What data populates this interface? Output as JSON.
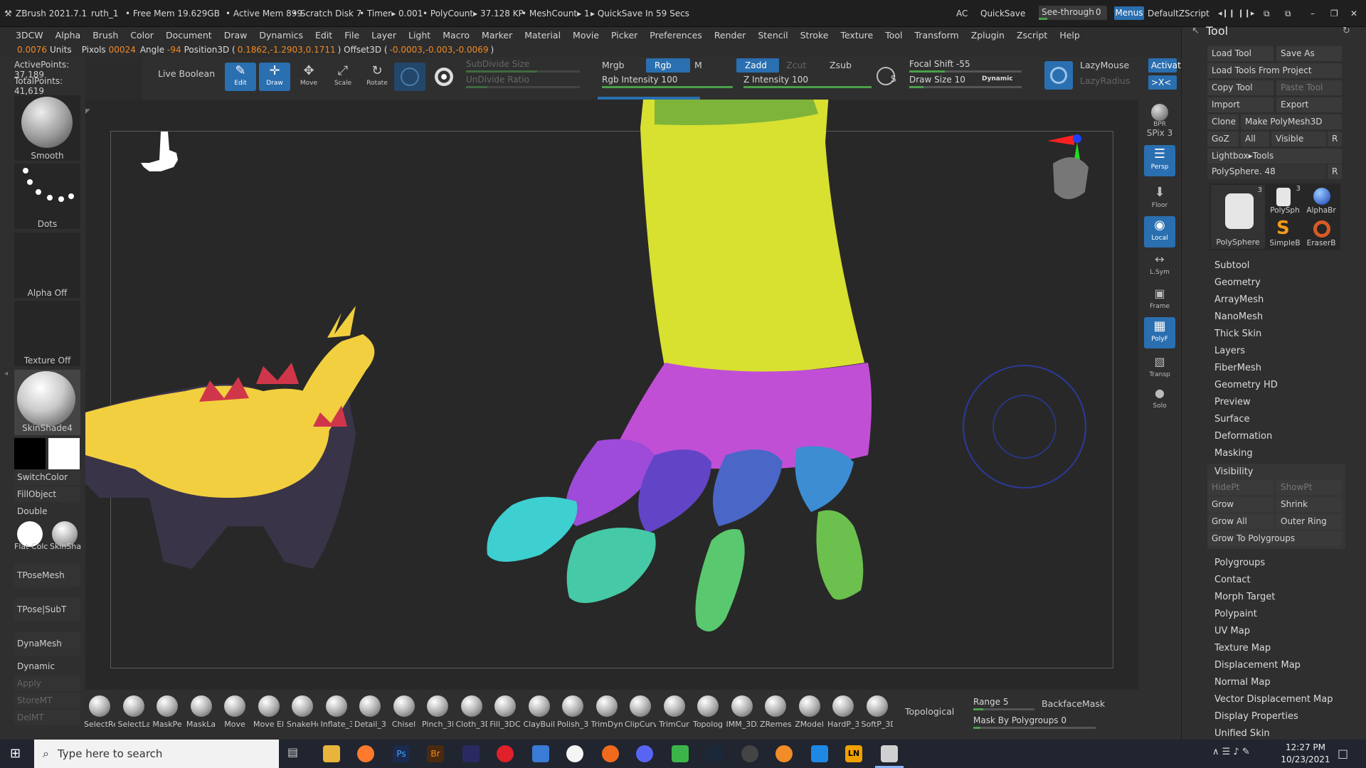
{
  "titlebar": {
    "app": "ZBrush 2021.7.1",
    "doc": "ruth_1",
    "free_mem": "• Free Mem 19.629GB",
    "active_mem": "• Active Mem 899",
    "scratch": "• Scratch Disk 7",
    "timer": "• Timer▸ 0.001",
    "polycount": "• PolyCount▸ 37.128 KP",
    "meshcount": "• MeshCount▸ 1",
    "quicksave_info": "▸ QuickSave In 59 Secs",
    "ac": "AC",
    "quicksave": "QuickSave",
    "see_through": "See-through",
    "see_through_value": "0",
    "menus": "Menus",
    "script": "DefaultZScript"
  },
  "menu": [
    "3DCW",
    "Alpha",
    "Brush",
    "Color",
    "Document",
    "Draw",
    "Dynamics",
    "Edit",
    "File",
    "Layer",
    "Light",
    "Macro",
    "Marker",
    "Material",
    "Movie",
    "Picker",
    "Preferences",
    "Render",
    "Stencil",
    "Stroke",
    "Texture",
    "Tool",
    "Transform",
    "Zplugin",
    "Zscript",
    "Help"
  ],
  "info": {
    "units_value": "0.0076",
    "units_label": "Units",
    "pixols_label": "Pixols",
    "pixols_value": "00024",
    "angle_label": "Angle",
    "angle_value": "-94",
    "pos_label": "Position3D (",
    "pos_value": "0.1862,-1.2903,0.1711",
    "offset_label": ") Offset3D (",
    "offset_value": "-0.0003,-0.003,-0.0069",
    "close": ")"
  },
  "left": {
    "active_points": "ActivePoints: 37,189",
    "total_points": "TotalPoints: 41,619",
    "brush": "Smooth",
    "stroke": "Dots",
    "alpha": "Alpha Off",
    "texture": "Texture Off",
    "material": "SkinShade4",
    "switch_color": "SwitchColor",
    "fill_object": "FillObject",
    "double": "Double",
    "flat_color": "Flat Colc",
    "skin_shade": "SkinSha",
    "tpose_mesh": "TPoseMesh",
    "tpose_subt": "TPose|SubT",
    "dynamesh": "DynaMesh",
    "dynamic": "Dynamic",
    "apply": "Apply",
    "store_mt": "StoreMT",
    "del_mt": "DelMT"
  },
  "shelf": {
    "live_boolean": "Live Boolean",
    "edit": "Edit",
    "draw": "Draw",
    "move": "Move",
    "scale": "Scale",
    "rotate": "Rotate",
    "subdivide_size": "SubDivide Size",
    "undivide_ratio": "UnDivide Ratio",
    "mrgb": "Mrgb",
    "rgb": "Rgb",
    "m": "M",
    "rgb_intensity": "Rgb Intensity 100",
    "zadd": "Zadd",
    "zcut": "Zcut",
    "zsub": "Zsub",
    "z_intensity": "Z Intensity 100",
    "s_label": "S",
    "focal_shift": "Focal Shift -55",
    "draw_size": "Draw Size 10",
    "dynamic": "Dynamic",
    "lazymouse": "LazyMouse",
    "lazyradius": "LazyRadius",
    "activate": "Activat",
    "xsym": ">X<"
  },
  "right_shelf": [
    "BPR",
    "SPix 3",
    "Persp",
    "Floor",
    "Local",
    "L.Sym",
    "Frame",
    "PolyF",
    "Transp",
    "Solo"
  ],
  "tool": {
    "title": "Tool",
    "load_tool": "Load Tool",
    "save_as": "Save As",
    "load_from_project": "Load Tools From Project",
    "copy_tool": "Copy Tool",
    "paste_tool": "Paste Tool",
    "import": "Import",
    "export": "Export",
    "clone": "Clone",
    "make_polymesh": "Make PolyMesh3D",
    "goz": "GoZ",
    "all": "All",
    "visible": "Visible",
    "r": "R",
    "lightbox": "Lightbox▸Tools",
    "polysphere": "PolySphere. 48",
    "thumbs": [
      "PolySphere",
      "PolySph",
      "AlphaBr",
      "SimpleB",
      "EraserB"
    ],
    "thumb_badge_1": "3",
    "thumb_badge_2": "3",
    "sections_a": [
      "Subtool",
      "Geometry",
      "ArrayMesh",
      "NanoMesh",
      "Thick Skin",
      "Layers",
      "FiberMesh",
      "Geometry HD",
      "Preview",
      "Surface",
      "Deformation",
      "Masking"
    ],
    "visibility": "Visibility",
    "hidept": "HidePt",
    "showpt": "ShowPt",
    "grow": "Grow",
    "shrink": "Shrink",
    "grow_all": "Grow All",
    "outer_ring": "Outer Ring",
    "grow_to_polygroups": "Grow To Polygroups",
    "sections_b": [
      "Polygroups",
      "Contact",
      "Morph Target",
      "Polypaint",
      "UV Map",
      "Texture Map",
      "Displacement Map",
      "Normal Map",
      "Vector Displacement Map",
      "Display Properties",
      "Unified Skin"
    ]
  },
  "brushes": [
    "SelectRe",
    "SelectLa",
    "MaskPe",
    "MaskLa",
    "Move",
    "Move El",
    "SnakeHo",
    "Inflate_3",
    "Detail_3",
    "Chisel",
    "Pinch_3D",
    "Cloth_3D",
    "Fill_3DC",
    "ClayBuil",
    "Polish_3",
    "TrimDyn",
    "ClipCurv",
    "TrimCur",
    "Topolog",
    "IMM_3DZ",
    "ZRemes",
    "ZModel",
    "HardP_3",
    "SoftP_3D"
  ],
  "bottom": {
    "topological": "Topological",
    "range": "Range 5",
    "backface": "BackfaceMask",
    "mask_polygroups": "Mask By Polygroups 0"
  },
  "taskbar": {
    "search": "Type here to search",
    "time": "12:27 PM",
    "date": "10/23/2021"
  },
  "colors": {
    "accent": "#2a6fb0",
    "orange": "#f08a24",
    "yellow_mesh": "#d8e030",
    "magenta_mesh": "#c14fd6"
  }
}
